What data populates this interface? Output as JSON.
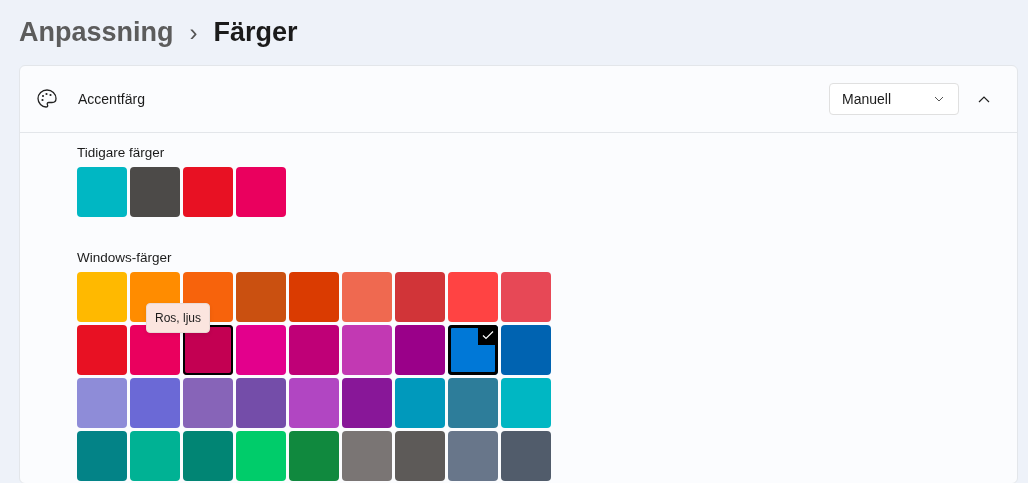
{
  "breadcrumb": {
    "parent": "Anpassning",
    "separator": "›",
    "current": "Färger"
  },
  "accent": {
    "label": "Accentfärg",
    "dropdown": {
      "value": "Manuell"
    },
    "expanded": true
  },
  "recent_colors": {
    "label": "Tidigare färger",
    "swatches": [
      {
        "color": "#00b7c3",
        "selected": false
      },
      {
        "color": "#4c4a48",
        "selected": false
      },
      {
        "color": "#e81123",
        "selected": false
      },
      {
        "color": "#ea005e",
        "selected": false
      }
    ]
  },
  "windows_colors": {
    "label": "Windows-färger",
    "swatches": [
      {
        "color": "#ffb900",
        "selected": false,
        "hovered": false
      },
      {
        "color": "#ff8c00",
        "selected": false,
        "hovered": false
      },
      {
        "color": "#f7630c",
        "selected": false,
        "hovered": false
      },
      {
        "color": "#ca5010",
        "selected": false,
        "hovered": false
      },
      {
        "color": "#da3b01",
        "selected": false,
        "hovered": false
      },
      {
        "color": "#ef6950",
        "selected": false,
        "hovered": false
      },
      {
        "color": "#d13438",
        "selected": false,
        "hovered": false
      },
      {
        "color": "#ff4343",
        "selected": false,
        "hovered": false
      },
      {
        "color": "#e74856",
        "selected": false,
        "hovered": false
      },
      {
        "color": "#e81123",
        "selected": false,
        "hovered": false
      },
      {
        "color": "#ea005e",
        "selected": false,
        "hovered": false
      },
      {
        "color": "#c30052",
        "selected": false,
        "hovered": true,
        "tooltip": "Ros, ljus"
      },
      {
        "color": "#e3008c",
        "selected": false,
        "hovered": false
      },
      {
        "color": "#bf0077",
        "selected": false,
        "hovered": false
      },
      {
        "color": "#c239b3",
        "selected": false,
        "hovered": false
      },
      {
        "color": "#9a0089",
        "selected": false,
        "hovered": false
      },
      {
        "color": "#0078d7",
        "selected": true,
        "hovered": false
      },
      {
        "color": "#0063b1",
        "selected": false,
        "hovered": false
      },
      {
        "color": "#8e8cd8",
        "selected": false,
        "hovered": false
      },
      {
        "color": "#6b69d6",
        "selected": false,
        "hovered": false
      },
      {
        "color": "#8764b8",
        "selected": false,
        "hovered": false
      },
      {
        "color": "#744da9",
        "selected": false,
        "hovered": false
      },
      {
        "color": "#b146c2",
        "selected": false,
        "hovered": false
      },
      {
        "color": "#881798",
        "selected": false,
        "hovered": false
      },
      {
        "color": "#0099bc",
        "selected": false,
        "hovered": false
      },
      {
        "color": "#2d7d9a",
        "selected": false,
        "hovered": false
      },
      {
        "color": "#00b7c3",
        "selected": false,
        "hovered": false
      },
      {
        "color": "#038387",
        "selected": false,
        "hovered": false
      },
      {
        "color": "#00b294",
        "selected": false,
        "hovered": false
      },
      {
        "color": "#018574",
        "selected": false,
        "hovered": false
      },
      {
        "color": "#00cc6a",
        "selected": false,
        "hovered": false
      },
      {
        "color": "#10893e",
        "selected": false,
        "hovered": false
      },
      {
        "color": "#7a7574",
        "selected": false,
        "hovered": false
      },
      {
        "color": "#5d5a58",
        "selected": false,
        "hovered": false
      },
      {
        "color": "#68768a",
        "selected": false,
        "hovered": false
      },
      {
        "color": "#515c6b",
        "selected": false,
        "hovered": false
      }
    ]
  }
}
